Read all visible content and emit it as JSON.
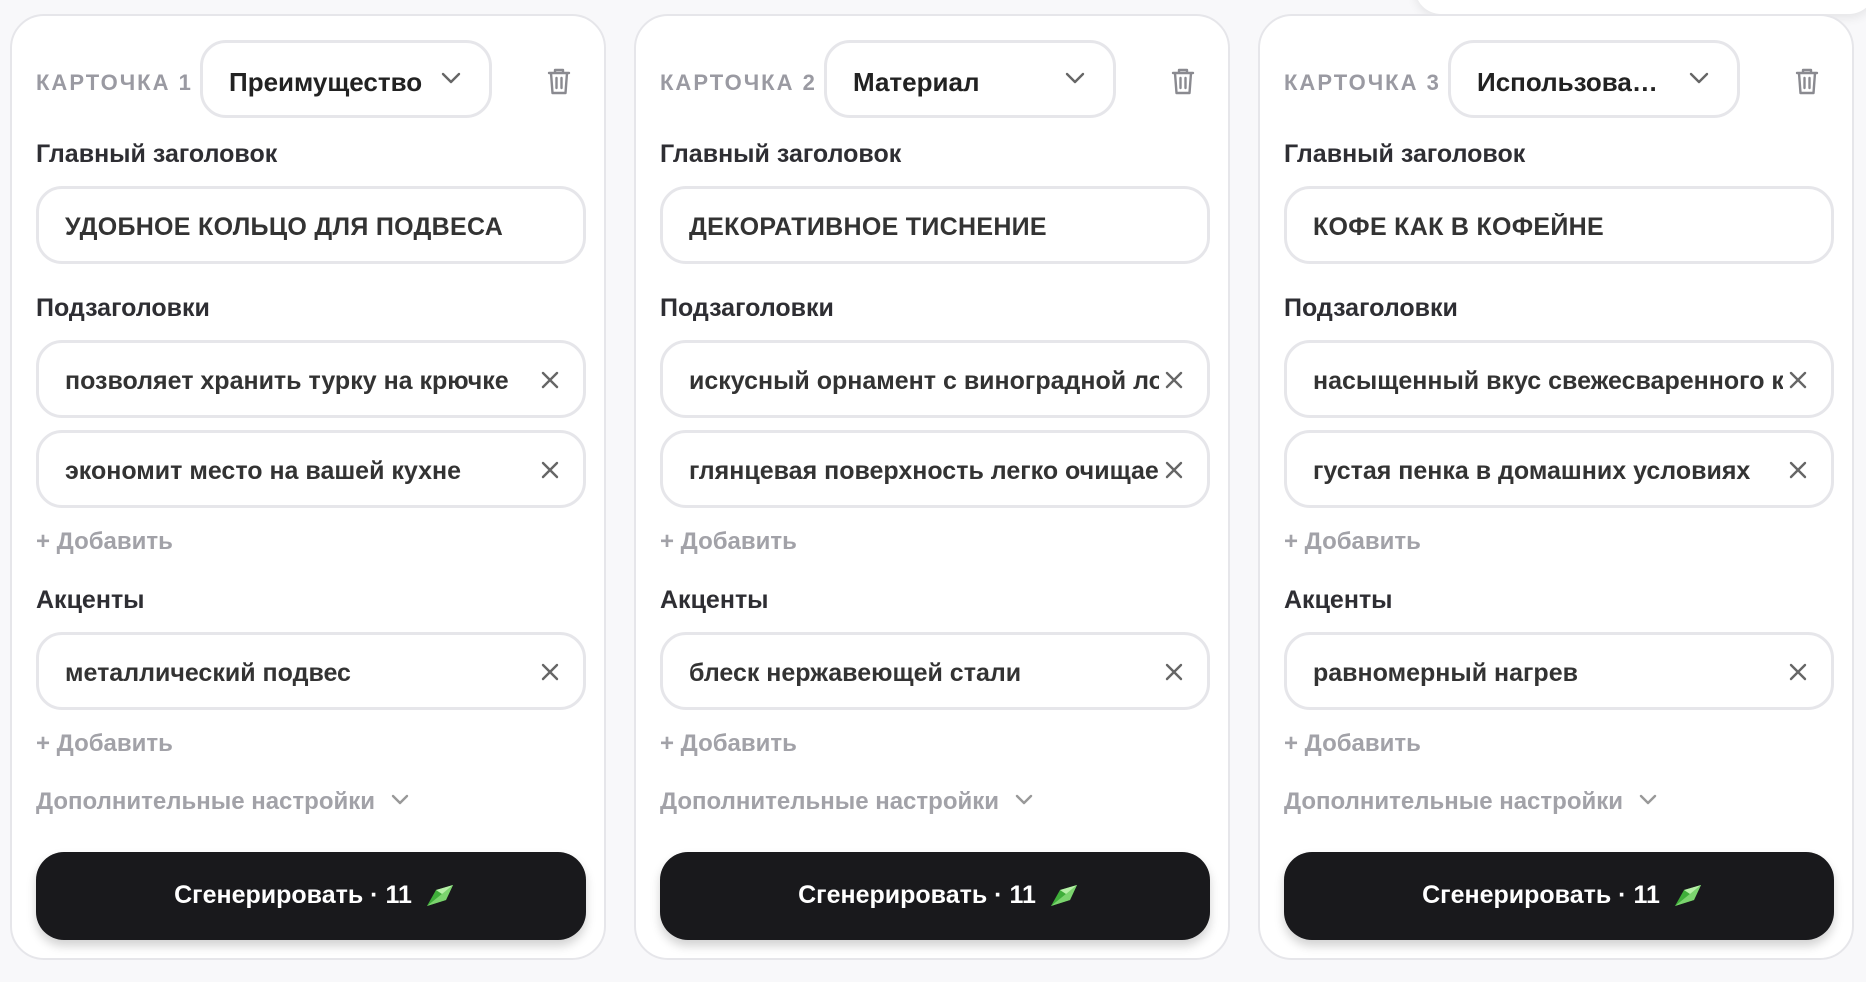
{
  "labels": {
    "main_title": "Главный заголовок",
    "subtitles": "Подзаголовки",
    "accents": "Акценты",
    "add": "+ Добавить",
    "more_settings": "Дополнительные настройки"
  },
  "colors": {
    "button_bg": "#19191c",
    "gem": "#3fae3a",
    "muted": "#a2a2a8"
  },
  "cards": [
    {
      "number": "КАРТОЧКА 1",
      "type": "Преимущество",
      "title": "УДОБНОЕ КОЛЬЦО ДЛЯ ПОДВЕСА",
      "subtitles": [
        "позволяет хранить турку на крючке",
        "экономит место на вашей кухне"
      ],
      "accents": [
        "металлический подвес"
      ],
      "generate_label": "Сгенерировать · 11"
    },
    {
      "number": "КАРТОЧКА 2",
      "type": "Материал",
      "title": "ДЕКОРАТИВНОЕ ТИСНЕНИЕ",
      "subtitles": [
        "искусный орнамент с виноградной лозой",
        "глянцевая поверхность легко очищается"
      ],
      "accents": [
        "блеск нержавеющей стали"
      ],
      "generate_label": "Сгенерировать · 11"
    },
    {
      "number": "КАРТОЧКА 3",
      "type": "Использова…",
      "title": "КОФЕ КАК В КОФЕЙНЕ",
      "subtitles": [
        "насыщенный вкус свежесваренного кофе",
        "густая пенка в домашних условиях"
      ],
      "accents": [
        "равномерный нагрев"
      ],
      "generate_label": "Сгенерировать · 11"
    }
  ]
}
